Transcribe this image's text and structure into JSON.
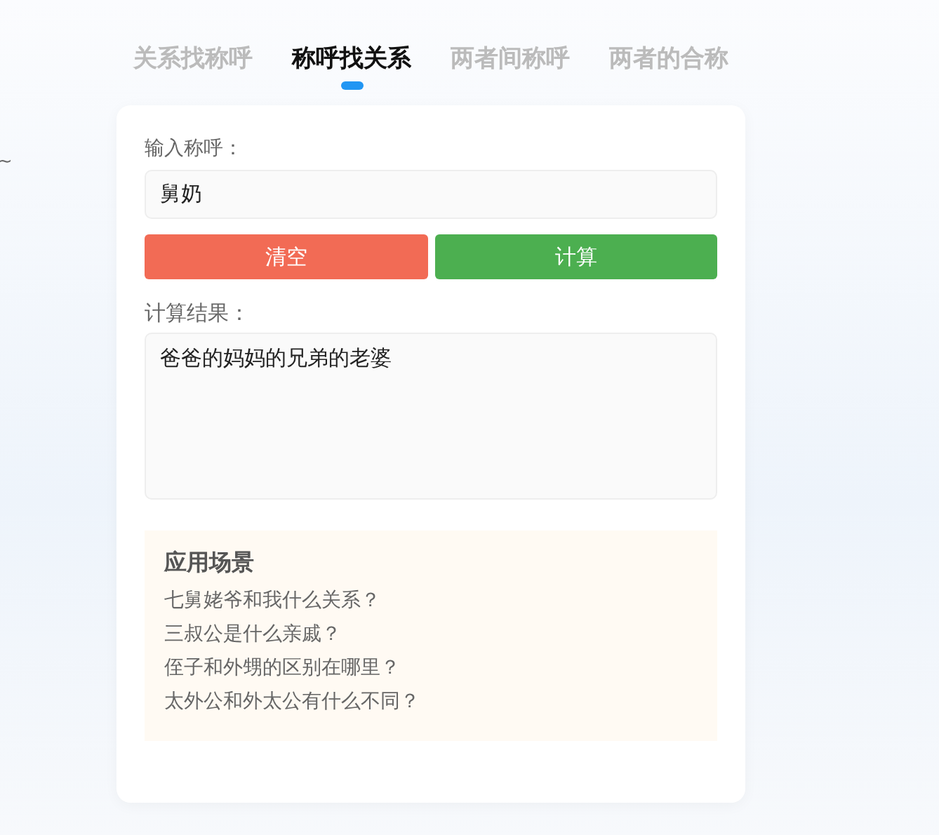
{
  "tabs": [
    {
      "label": "关系找称呼",
      "selected": false
    },
    {
      "label": "称呼找关系",
      "selected": true
    },
    {
      "label": "两者间称呼",
      "selected": false
    },
    {
      "label": "两者的合称",
      "selected": false
    }
  ],
  "side_text": "~",
  "input": {
    "label": "输入称呼：",
    "value": "舅奶"
  },
  "buttons": [
    {
      "label": "清空",
      "kind": "clear"
    },
    {
      "label": "计算",
      "kind": "calc"
    }
  ],
  "result": {
    "label": "计算结果：",
    "value": "爸爸的妈妈的兄弟的老婆"
  },
  "scenes": {
    "title": "应用场景",
    "items": [
      "七舅姥爷和我什么关系？",
      "三叔公是什么亲戚？",
      "侄子和外甥的区别在哪里？",
      "太外公和外太公有什么不同？"
    ]
  }
}
